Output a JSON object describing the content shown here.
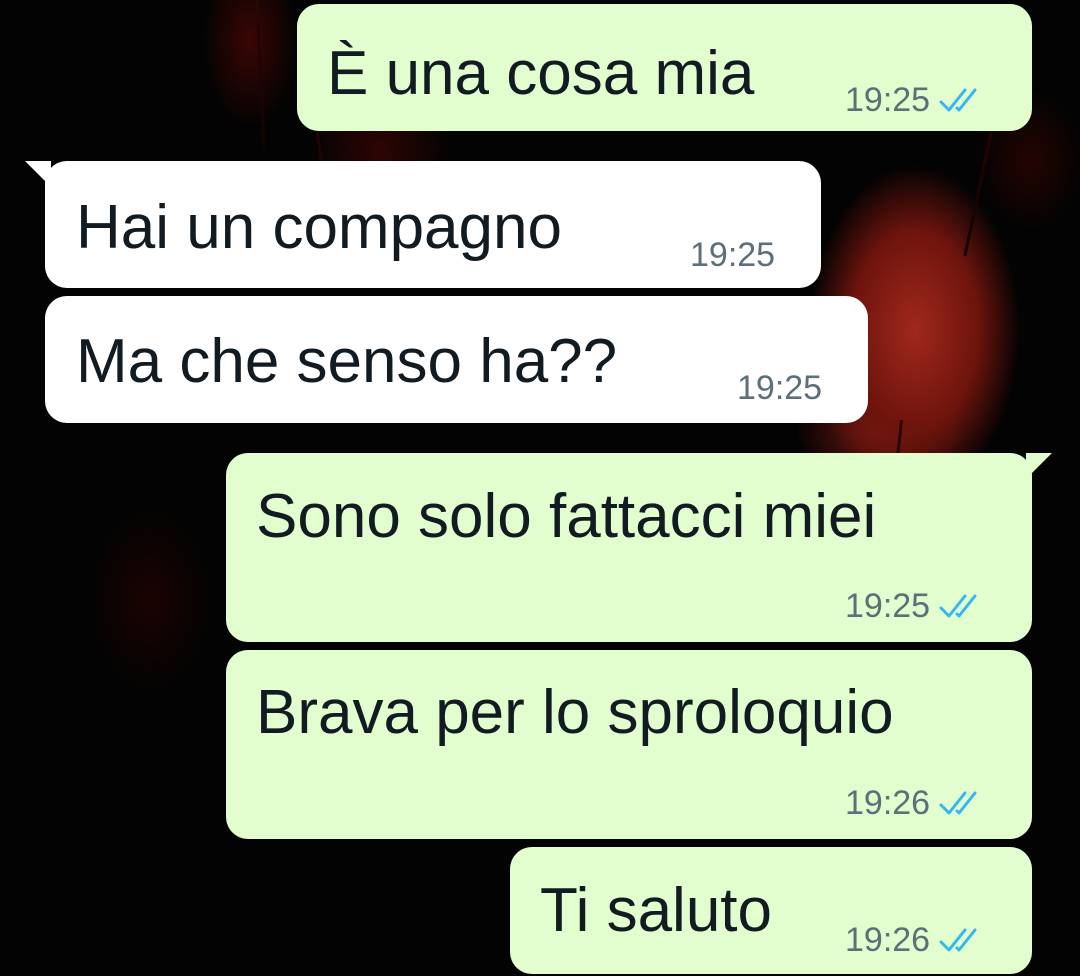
{
  "conversation": {
    "messages": [
      {
        "direction": "outgoing",
        "text": "È una cosa mia",
        "time": "19:25",
        "status": "double-check-icon"
      },
      {
        "direction": "incoming",
        "text": "Hai un compagno",
        "time": "19:25"
      },
      {
        "direction": "incoming",
        "text": "Ma che senso ha??",
        "time": "19:25"
      },
      {
        "direction": "outgoing",
        "text": "Sono solo fattacci miei",
        "time": "19:25",
        "status": "double-check-icon"
      },
      {
        "direction": "outgoing",
        "text": "Brava per lo sproloquio",
        "time": "19:26",
        "status": "double-check-icon"
      },
      {
        "direction": "outgoing",
        "text": "Ti saluto",
        "time": "19:26",
        "status": "double-check-icon"
      }
    ]
  },
  "colors": {
    "outgoing_bubble": "#e2fecf",
    "incoming_bubble": "#ffffff",
    "text": "#111b21",
    "timestamp": "#5d6f78",
    "read_ticks": "#34b7f1",
    "wallpaper_accent": "#a0281c"
  }
}
